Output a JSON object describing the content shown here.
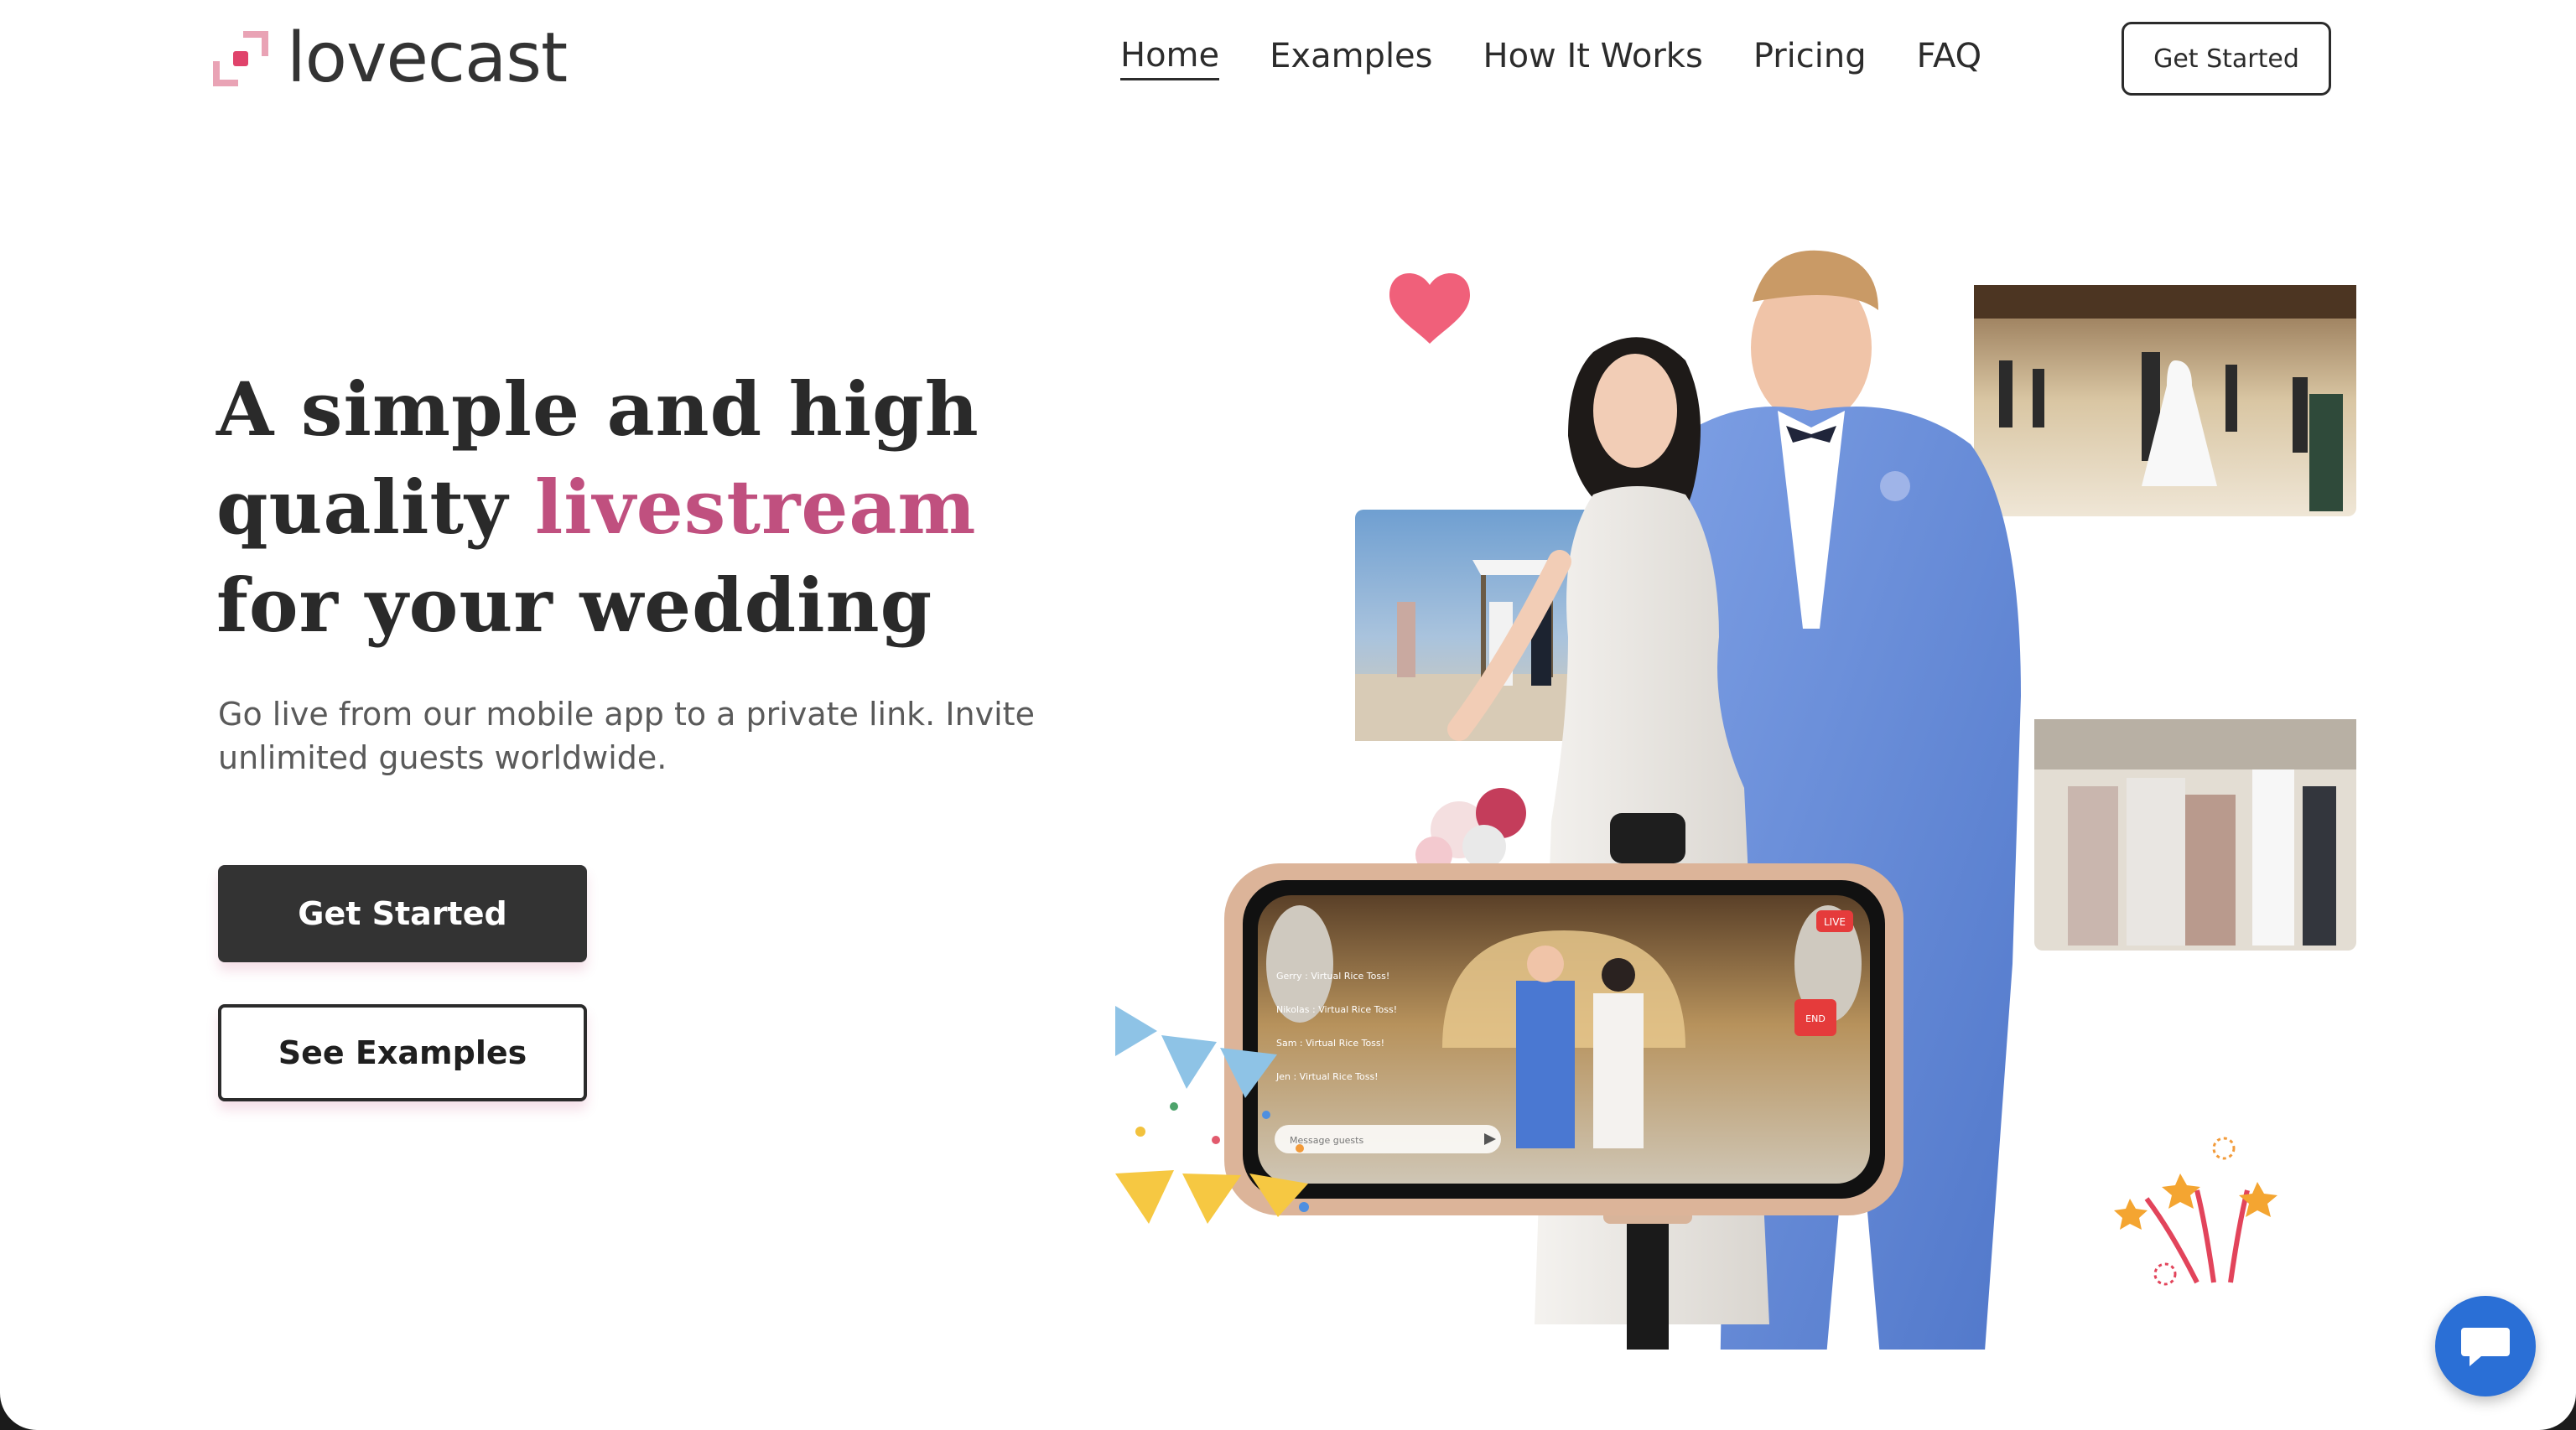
{
  "brand": {
    "name": "lovecast",
    "logo_icon": "lovecast-logo-icon",
    "accent_color": "#c0507f",
    "logo_dot_color": "#e0436b",
    "logo_bracket_color": "#e9a3b5"
  },
  "nav": {
    "items": [
      {
        "label": "Home",
        "active": true
      },
      {
        "label": "Examples",
        "active": false
      },
      {
        "label": "How It Works",
        "active": false
      },
      {
        "label": "Pricing",
        "active": false
      },
      {
        "label": "FAQ",
        "active": false
      }
    ],
    "cta_label": "Get Started"
  },
  "hero": {
    "title_part1": "A simple and high quality ",
    "title_accent": "livestream",
    "title_part2": " for your wedding",
    "subtitle": "Go live from our mobile app to a private link. Invite unlimited guests worldwide.",
    "primary_button": "Get Started",
    "secondary_button": "See Examples"
  },
  "phone_screen": {
    "live_badge": "LIVE",
    "end_button": "END",
    "comments": [
      {
        "author": "Gerry",
        "text": "Virtual Rice Toss!"
      },
      {
        "author": "Nikolas",
        "text": "Virtual Rice Toss!"
      },
      {
        "author": "Sam",
        "text": "Virtual Rice Toss!"
      },
      {
        "author": "Jen",
        "text": "Virtual Rice Toss!"
      }
    ],
    "message_placeholder": "Message guests"
  },
  "chat_widget": {
    "icon": "chat-bubble-icon",
    "color": "#2a6fd6"
  }
}
